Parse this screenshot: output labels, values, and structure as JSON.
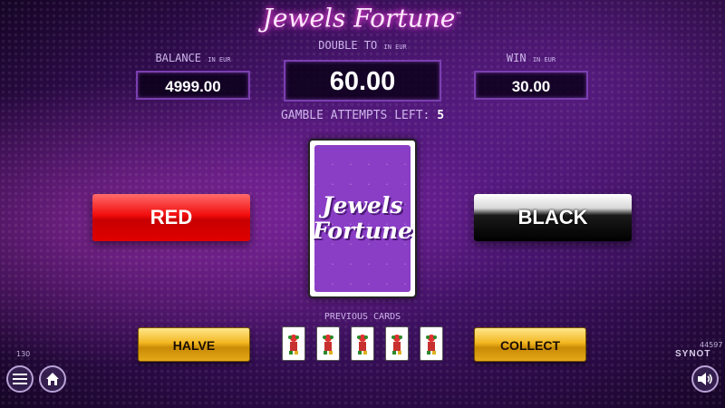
{
  "title": {
    "text": "Jewels Fortune",
    "tm": "™"
  },
  "balance": {
    "label": "BALANCE",
    "unit": "IN EUR",
    "value": "4999.00"
  },
  "double_to": {
    "label": "DOUBLE TO",
    "unit": "IN EUR",
    "value": "60.00"
  },
  "win": {
    "label": "WIN",
    "unit": "IN EUR",
    "value": "30.00"
  },
  "gamble": {
    "label": "GAMBLE ATTEMPTS LEFT:",
    "count": "5"
  },
  "buttons": {
    "red": "RED",
    "black": "BLACK",
    "halve": "HALVE",
    "collect": "COLLECT"
  },
  "card_back": {
    "line1": "Jewels",
    "line2": "Fortune"
  },
  "previous_cards": {
    "label": "PREVIOUS CARDS",
    "cards": [
      {
        "icon": "joker-icon"
      },
      {
        "icon": "joker-icon"
      },
      {
        "icon": "joker-icon"
      },
      {
        "icon": "joker-icon"
      },
      {
        "icon": "joker-icon"
      }
    ]
  },
  "footer": {
    "left_code": "130",
    "right_code": "44597",
    "brand": "SYNOT",
    "menu_icon": "hamburger-menu-icon",
    "home_icon": "home-icon",
    "sound_icon": "speaker-icon"
  },
  "colors": {
    "red_button": "#e00000",
    "black_button": "#000000",
    "gold_button": "#f2b620",
    "background": "#4a1575",
    "card_purple": "#8a3ec5"
  }
}
